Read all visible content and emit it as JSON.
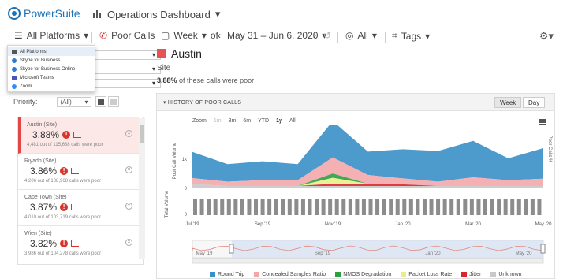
{
  "app": {
    "logo_text": "PowerSuite",
    "dashboard_title": "Operations Dashboard"
  },
  "toolbar": {
    "platform": "All Platforms",
    "poor_calls": "Poor Calls",
    "week_label": "Week",
    "of_label": "of",
    "date_range": "May 31 – Jun 6, 2020",
    "all_label": "All",
    "tags_label": "Tags"
  },
  "platform_menu": [
    "All Platforms",
    "Skype for Business",
    "Skype for Business Online",
    "Microsoft Teams",
    "Zoom"
  ],
  "sidebar": {
    "priority_label": "Priority:",
    "priority_value": "(All)",
    "sites": [
      {
        "name": "Austin (Site)",
        "pct": "3.88%",
        "sub": "4,481 out of 115,638 calls were poor"
      },
      {
        "name": "Riyadh (Site)",
        "pct": "3.86%",
        "sub": "4,206 out of 108,968 calls were poor"
      },
      {
        "name": "Cape Town (Site)",
        "pct": "3.87%",
        "sub": "4,010 out of 103,719 calls were poor"
      },
      {
        "name": "Wien (Site)",
        "pct": "3.82%",
        "sub": "3,986 out of 104,278 calls were poor"
      }
    ]
  },
  "site": {
    "title": "Austin",
    "type": "Site",
    "poor_pct": "3.88%",
    "poor_text": "of these calls were poor"
  },
  "history": {
    "title": "HISTORY OF POOR CALLS",
    "toggle_week": "Week",
    "toggle_day": "Day",
    "zoom_label": "Zoom",
    "zoom_options": [
      "1m",
      "3m",
      "6m",
      "YTD",
      "1y",
      "All"
    ]
  },
  "chart_data": {
    "type": "area",
    "x": [
      "Jul '19",
      "Aug '19",
      "Sep '19",
      "Oct '19",
      "Nov '19",
      "Dec '19",
      "Jan '20",
      "Feb '20",
      "Mar '20",
      "Apr '20",
      "May '20"
    ],
    "x_tick_labels": [
      "Jul '19",
      "Sep '19",
      "Nov '19",
      "Jan '20",
      "Mar '20",
      "May '20"
    ],
    "ylabel": "Poor Call Volume",
    "ylabel_right": "Poor Calls %",
    "volume_label": "Total Volume",
    "y_ticks": [
      "1k",
      "0"
    ],
    "volume_ticks": [
      "0"
    ],
    "navigator_labels": [
      "May '19",
      "Sep '19",
      "Jan '20",
      "May '20"
    ],
    "series": [
      {
        "name": "Round Trip",
        "color": "#3a8fc8",
        "values": [
          900,
          600,
          650,
          550,
          1250,
          800,
          1000,
          1050,
          1250,
          750,
          1050
        ]
      },
      {
        "name": "Concealed Samples Ratio",
        "color": "#f4a7ab",
        "values": [
          200,
          150,
          200,
          200,
          550,
          300,
          200,
          150,
          300,
          200,
          250
        ]
      },
      {
        "name": "NMOS Degradation",
        "color": "#2e9e3e",
        "values": [
          0,
          0,
          0,
          0,
          150,
          0,
          0,
          0,
          0,
          0,
          0
        ]
      },
      {
        "name": "Packet Loss Rate",
        "color": "#e8ee8a",
        "values": [
          0,
          0,
          0,
          0,
          200,
          0,
          0,
          0,
          0,
          0,
          0
        ]
      },
      {
        "name": "Jitter",
        "color": "#d8262b",
        "values": [
          0,
          0,
          0,
          0,
          80,
          80,
          60,
          0,
          0,
          0,
          0
        ]
      },
      {
        "name": "Unknown",
        "color": "#c9c9c9",
        "values": [
          150,
          80,
          80,
          80,
          80,
          80,
          80,
          80,
          80,
          80,
          80
        ]
      }
    ],
    "legend_position": "bottom"
  }
}
